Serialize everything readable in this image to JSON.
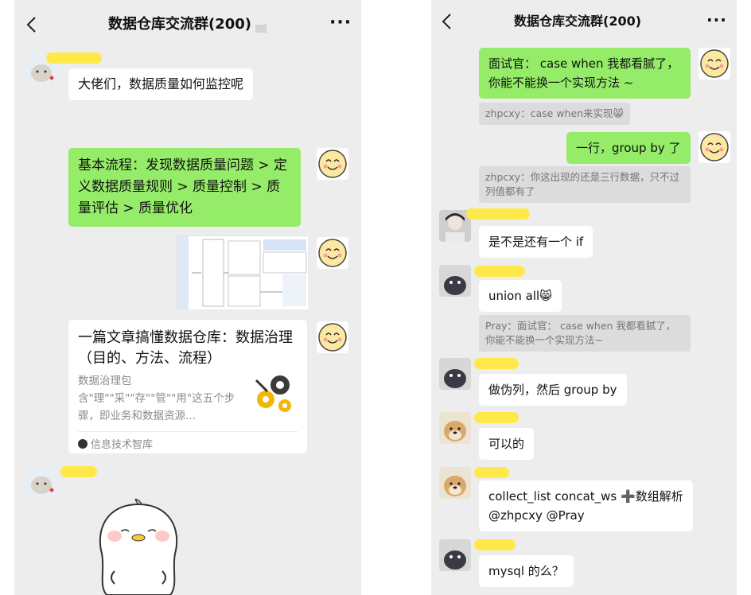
{
  "left": {
    "title": "数据仓库交流群(200)",
    "more": "···",
    "messages": {
      "q1": "大佬们，数据质量如何监控呢",
      "a1": "基本流程：发现数据质量问题 > 定义数据质量规则 > 质量控制 > 质量评估 > 质量优化",
      "article": {
        "title": "一篇文章搞懂数据仓库：数据治理（目的、方法、流程）",
        "desc": "数据治理包含\"理\"\"采\"\"存\"\"管\"\"用\"这五个步骤，即业务和数据资源...",
        "source": "信息技术智库"
      }
    }
  },
  "right": {
    "title": "数据仓库交流群(200)",
    "more": "···",
    "messages": {
      "m1": "面试官： case when 我都看腻了，你能不能换一个实现方法 ~",
      "q1": "zhpcxy：case when来实现😸",
      "m2": "一行，group by 了",
      "q2": "zhpcxy：你这出现的还是三行数据，只不过列值都有了",
      "m3": "是不是还有一个 if",
      "m4": "union all😸",
      "q3": "Pray：面试官： case when 我都看腻了，你能不能换一个实现方法~",
      "m5": "做伪列，然后 group by",
      "m6": "可以的",
      "m7a": "collect_list concat_ws ➕数组解析",
      "m7b": "@zhpcxy @Pray",
      "m8": "mysql 的么？"
    }
  },
  "colors": {
    "bg": "#ededed",
    "bubble_green": "#95ec69",
    "bubble_white": "#ffffff",
    "name_highlight": "#ffe84a"
  },
  "icons": [
    "back-arrow-icon",
    "more-dots-icon",
    "mute-icon"
  ]
}
